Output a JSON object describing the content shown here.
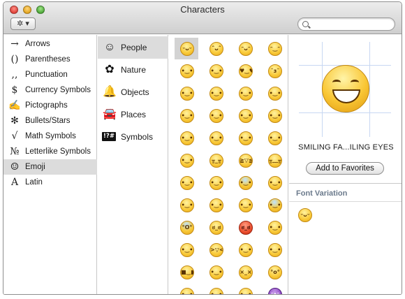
{
  "window": {
    "title": "Characters"
  },
  "toolbar": {
    "gear_label": "✲ ▾",
    "search_placeholder": ""
  },
  "categories": [
    {
      "icon": "→",
      "label": "Arrows"
    },
    {
      "icon": "()",
      "label": "Parentheses"
    },
    {
      "icon": ",,",
      "label": "Punctuation"
    },
    {
      "icon": "$",
      "label": "Currency Symbols"
    },
    {
      "icon": "✍",
      "label": "Pictographs"
    },
    {
      "icon": "✻",
      "label": "Bullets/Stars"
    },
    {
      "icon": "√",
      "label": "Math Symbols"
    },
    {
      "icon": "№",
      "label": "Letterlike Symbols"
    },
    {
      "icon": "☺",
      "label": "Emoji"
    },
    {
      "icon": "A",
      "label": "Latin"
    }
  ],
  "selected_category": "Emoji",
  "subcategories": [
    {
      "icon": "☺",
      "label": "People"
    },
    {
      "icon": "✿",
      "label": "Nature"
    },
    {
      "icon": "🔔",
      "label": "Objects"
    },
    {
      "icon": "🚘",
      "label": "Places"
    },
    {
      "icon": "!?#",
      "label": "Symbols"
    }
  ],
  "selected_subcategory": "People",
  "emoji_grid": [
    [
      "grinning-squint",
      "grin",
      "grinning",
      "smiling"
    ],
    [
      "blush",
      "wink",
      "heart-eyes",
      "kissing-heart"
    ],
    [
      "kissing-closed-eyes",
      "kissing",
      "kissing-smiling-eyes",
      "stuck-out-tongue-winking"
    ],
    [
      "stuck-out-tongue-closed-eyes",
      "stuck-out-tongue",
      "flushed",
      "grimacing"
    ],
    [
      "pensive",
      "relieved",
      "unamused",
      "disappointed"
    ],
    [
      "persevere",
      "cry",
      "joy",
      "sob"
    ],
    [
      "sleepy",
      "disappointed-relieved",
      "cold-sweat",
      "sweat-smile"
    ],
    [
      "sweat",
      "weary",
      "tired",
      "fearful"
    ],
    [
      "scream",
      "angry",
      "rage",
      "triumph"
    ],
    [
      "confounded",
      "laughing",
      "yum",
      "mask"
    ],
    [
      "sunglasses",
      "sleeping",
      "dizzy",
      "astonished"
    ],
    [
      "worried",
      "frowning",
      "anguished",
      "imp"
    ]
  ],
  "selected_emoji": "grinning-squint",
  "detail": {
    "char_name": "SMILING FA...ILING EYES",
    "add_favorites_label": "Add to Favorites",
    "font_variation_label": "Font Variation"
  },
  "colors": {
    "selection": "#dcdcdc",
    "emoji_yellow": "#f9c937",
    "header_blue": "#6b7a8c"
  }
}
